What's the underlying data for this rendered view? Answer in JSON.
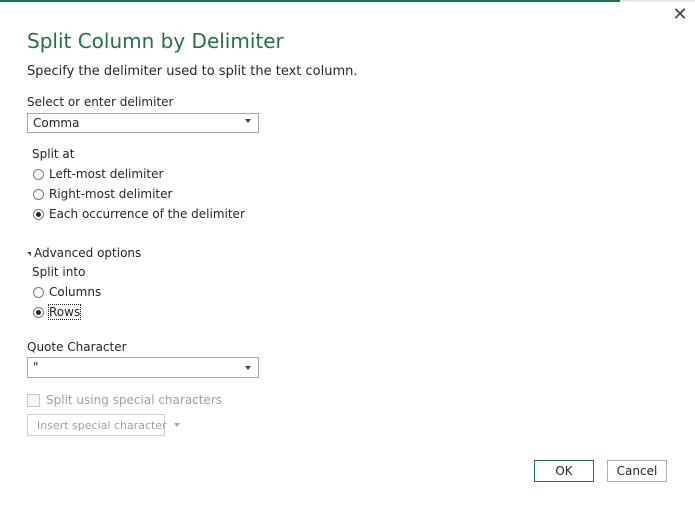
{
  "dialog": {
    "title": "Split Column by Delimiter",
    "subtitle": "Specify the delimiter used to split the text column.",
    "close_glyph": "✕"
  },
  "delimiter": {
    "label": "Select or enter delimiter",
    "selected": "Comma"
  },
  "split_at": {
    "label": "Split at",
    "options": [
      {
        "label": "Left-most delimiter",
        "checked": false
      },
      {
        "label": "Right-most delimiter",
        "checked": false
      },
      {
        "label": "Each occurrence of the delimiter",
        "checked": true
      }
    ]
  },
  "advanced": {
    "toggle_label": "Advanced options",
    "expanded": true,
    "split_into": {
      "label": "Split into",
      "options": [
        {
          "label": "Columns",
          "checked": false
        },
        {
          "label": "Rows",
          "checked": true
        }
      ]
    },
    "quote_char": {
      "label": "Quote Character",
      "selected": "\""
    },
    "special_chars": {
      "label": "Split using special characters",
      "checked": false,
      "enabled": false
    },
    "insert_special": {
      "label": "Insert special character",
      "enabled": false
    }
  },
  "buttons": {
    "ok": "OK",
    "cancel": "Cancel"
  },
  "colors": {
    "accent": "#217346"
  }
}
